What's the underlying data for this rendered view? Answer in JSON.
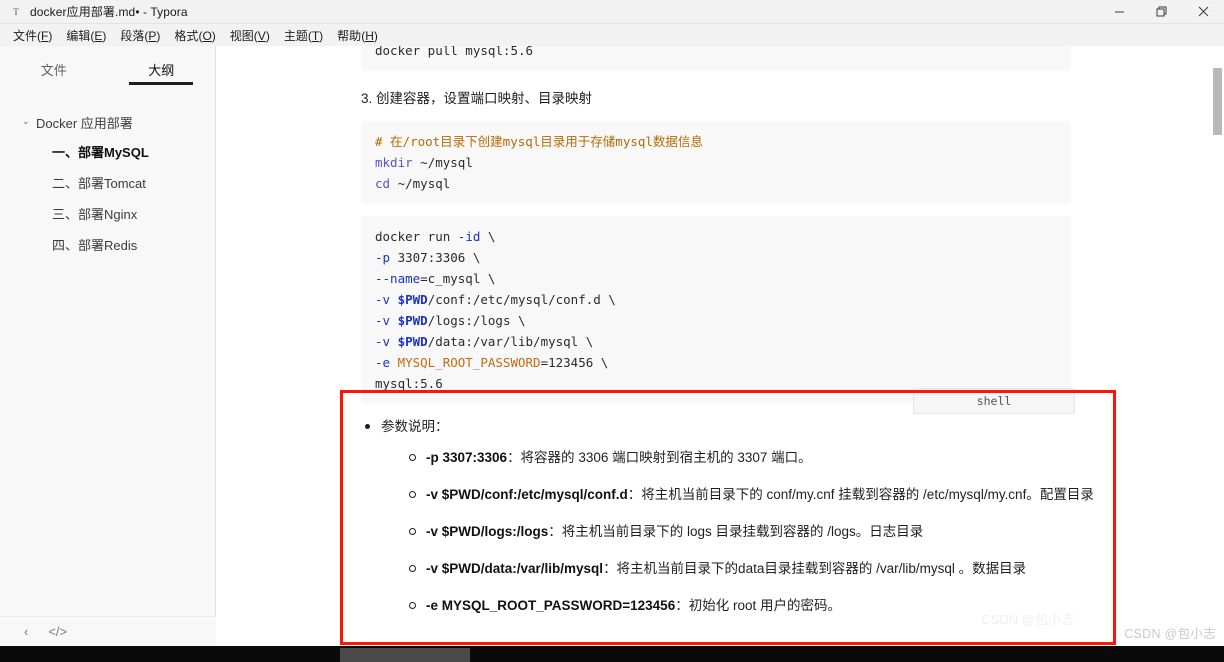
{
  "window": {
    "icon_glyph": "T",
    "title": "docker应用部署.md• - Typora",
    "buttons": {
      "minimize": "minimize-button",
      "maximize": "maximize-button",
      "close": "close-button"
    }
  },
  "menubar": {
    "items": [
      {
        "label": "文件",
        "mnemonic": "F"
      },
      {
        "label": "编辑",
        "mnemonic": "E"
      },
      {
        "label": "段落",
        "mnemonic": "P"
      },
      {
        "label": "格式",
        "mnemonic": "O"
      },
      {
        "label": "视图",
        "mnemonic": "V"
      },
      {
        "label": "主题",
        "mnemonic": "T"
      },
      {
        "label": "帮助",
        "mnemonic": "H"
      }
    ]
  },
  "sidebar": {
    "tabs": [
      {
        "label": "文件",
        "active": false
      },
      {
        "label": "大纲",
        "active": true
      }
    ],
    "outline": {
      "caret": "⌄",
      "root": "Docker 应用部署",
      "items": [
        {
          "label": "一、部署MySQL",
          "active": true
        },
        {
          "label": "二、部署Tomcat",
          "active": false
        },
        {
          "label": "三、部署Nginx",
          "active": false
        },
        {
          "label": "四、部署Redis",
          "active": false
        }
      ]
    },
    "footer": {
      "back_icon": "‹",
      "source_icon": "</>"
    }
  },
  "editor": {
    "code_block_1": {
      "lines": [
        {
          "text": "docker pull mysql:5.6",
          "cls": "plain"
        }
      ]
    },
    "paragraph_1": "3. 创建容器，设置端口映射、目录映射",
    "code_block_2": {
      "comment": "# 在/root目录下创建mysql目录用于存储mysql数据信息",
      "line2_kw": "mkdir",
      "line2_rest": " ~/mysql",
      "line3_kw": "cd",
      "line3_rest": " ~/mysql"
    },
    "code_block_3": {
      "l1_plain": "docker run ",
      "l1_flag": "-id",
      "l1_tail": " \\",
      "l2_flag": "-p",
      "l2_plain": " 3307:3306 \\",
      "l3_flag": "--name",
      "l3_plain": "=c_mysql \\",
      "l4_flag": "-v ",
      "l4_var": "$PWD",
      "l4_plain": "/conf:/etc/mysql/conf.d \\",
      "l5_flag": "-v ",
      "l5_var": "$PWD",
      "l5_plain": "/logs:/logs \\",
      "l6_flag": "-v ",
      "l6_var": "$PWD",
      "l6_plain": "/data:/var/lib/mysql \\",
      "l7_flag": "-e ",
      "l7_env": "MYSQL_ROOT_PASSWORD",
      "l7_plain": "=123456 \\",
      "l8_plain": "mysql:5.6"
    },
    "lang_tag": "shell",
    "params_heading": "参数说明：",
    "params": [
      {
        "code": "-p 3307:3306",
        "desc": "：将容器的 3306 端口映射到宿主机的 3307 端口。"
      },
      {
        "code": "-v $PWD/conf:/etc/mysql/conf.d",
        "desc": "：将主机当前目录下的 conf/my.cnf 挂载到容器的 /etc/mysql/my.cnf。配置目录"
      },
      {
        "code": "-v $PWD/logs:/logs",
        "desc": "：将主机当前目录下的 logs 目录挂载到容器的 /logs。日志目录"
      },
      {
        "code": "-v $PWD/data:/var/lib/mysql",
        "desc": "：将主机当前目录下的data目录挂载到容器的 /var/lib/mysql 。数据目录"
      },
      {
        "code": "-e MYSQL_ROOT_PASSWORD=123456",
        "desc": "：初始化 root 用户的密码。"
      }
    ]
  },
  "annotation": {
    "highlight_color": "#fb1606"
  },
  "watermark": {
    "text": "CSDN @包小志"
  }
}
